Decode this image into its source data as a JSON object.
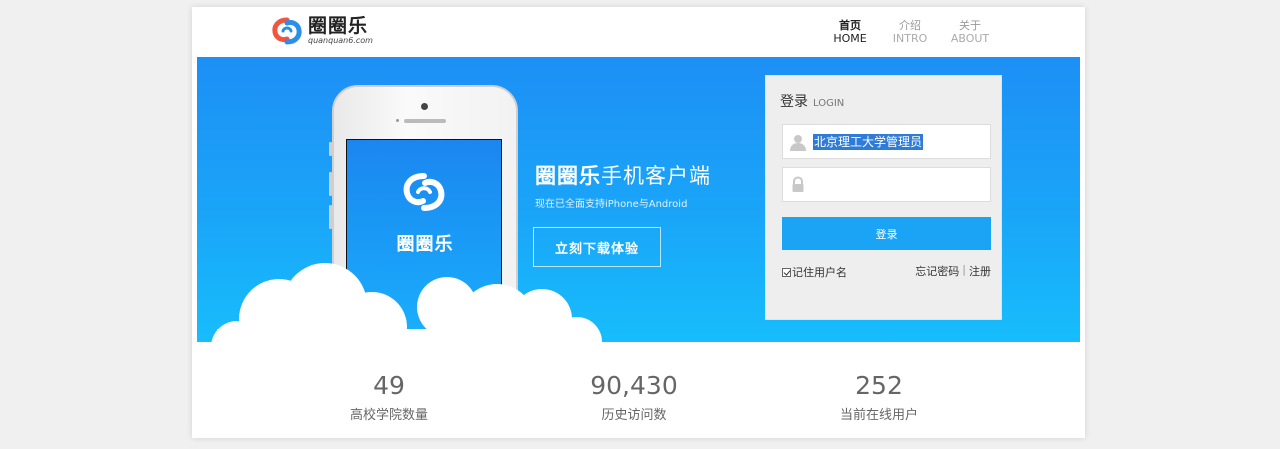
{
  "header": {
    "logo_cn": "圈圈乐",
    "logo_url": "quanquan6.com",
    "nav": [
      {
        "cn": "首页",
        "en": "HOME",
        "active": true
      },
      {
        "cn": "介绍",
        "en": "INTRO",
        "active": false
      },
      {
        "cn": "关于",
        "en": "ABOUT",
        "active": false
      }
    ]
  },
  "banner": {
    "phone_app_name": "圈圈乐",
    "promo_title_bold": "圈圈乐",
    "promo_title_rest": "手机客户端",
    "promo_subtitle": "现在已全面支持iPhone与Android",
    "download_label": "立刻下载体验"
  },
  "login": {
    "title": "登录",
    "title_en": "LOGIN",
    "username_value": "北京理工大学管理员",
    "password_value": "",
    "submit_label": "登录",
    "remember_label": "记住用户名",
    "remember_checked": true,
    "forgot_label": "忘记密码",
    "separator": "|",
    "register_label": "注册"
  },
  "stats": [
    {
      "value": "49",
      "label": "高校学院数量"
    },
    {
      "value": "90,430",
      "label": "历史访问数"
    },
    {
      "value": "252",
      "label": "当前在线用户"
    }
  ],
  "colors": {
    "brand_blue": "#1ba4f5",
    "logo_red": "#f0553f",
    "logo_blue": "#2a8fe8"
  }
}
